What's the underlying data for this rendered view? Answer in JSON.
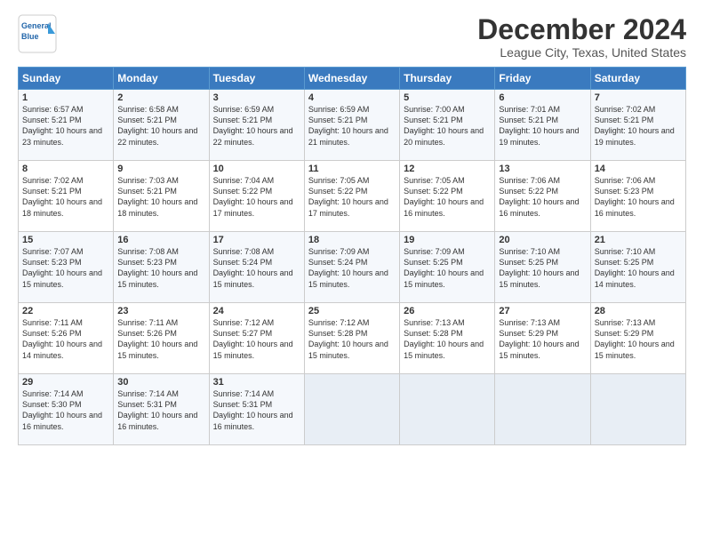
{
  "logo": {
    "line1": "General",
    "line2": "Blue"
  },
  "title": "December 2024",
  "subtitle": "League City, Texas, United States",
  "header": {
    "accent_color": "#3a7abf"
  },
  "days_of_week": [
    "Sunday",
    "Monday",
    "Tuesday",
    "Wednesday",
    "Thursday",
    "Friday",
    "Saturday"
  ],
  "weeks": [
    [
      {
        "num": "1",
        "sunrise": "Sunrise: 6:57 AM",
        "sunset": "Sunset: 5:21 PM",
        "daylight": "Daylight: 10 hours and 23 minutes."
      },
      {
        "num": "2",
        "sunrise": "Sunrise: 6:58 AM",
        "sunset": "Sunset: 5:21 PM",
        "daylight": "Daylight: 10 hours and 22 minutes."
      },
      {
        "num": "3",
        "sunrise": "Sunrise: 6:59 AM",
        "sunset": "Sunset: 5:21 PM",
        "daylight": "Daylight: 10 hours and 22 minutes."
      },
      {
        "num": "4",
        "sunrise": "Sunrise: 6:59 AM",
        "sunset": "Sunset: 5:21 PM",
        "daylight": "Daylight: 10 hours and 21 minutes."
      },
      {
        "num": "5",
        "sunrise": "Sunrise: 7:00 AM",
        "sunset": "Sunset: 5:21 PM",
        "daylight": "Daylight: 10 hours and 20 minutes."
      },
      {
        "num": "6",
        "sunrise": "Sunrise: 7:01 AM",
        "sunset": "Sunset: 5:21 PM",
        "daylight": "Daylight: 10 hours and 19 minutes."
      },
      {
        "num": "7",
        "sunrise": "Sunrise: 7:02 AM",
        "sunset": "Sunset: 5:21 PM",
        "daylight": "Daylight: 10 hours and 19 minutes."
      }
    ],
    [
      {
        "num": "8",
        "sunrise": "Sunrise: 7:02 AM",
        "sunset": "Sunset: 5:21 PM",
        "daylight": "Daylight: 10 hours and 18 minutes."
      },
      {
        "num": "9",
        "sunrise": "Sunrise: 7:03 AM",
        "sunset": "Sunset: 5:21 PM",
        "daylight": "Daylight: 10 hours and 18 minutes."
      },
      {
        "num": "10",
        "sunrise": "Sunrise: 7:04 AM",
        "sunset": "Sunset: 5:22 PM",
        "daylight": "Daylight: 10 hours and 17 minutes."
      },
      {
        "num": "11",
        "sunrise": "Sunrise: 7:05 AM",
        "sunset": "Sunset: 5:22 PM",
        "daylight": "Daylight: 10 hours and 17 minutes."
      },
      {
        "num": "12",
        "sunrise": "Sunrise: 7:05 AM",
        "sunset": "Sunset: 5:22 PM",
        "daylight": "Daylight: 10 hours and 16 minutes."
      },
      {
        "num": "13",
        "sunrise": "Sunrise: 7:06 AM",
        "sunset": "Sunset: 5:22 PM",
        "daylight": "Daylight: 10 hours and 16 minutes."
      },
      {
        "num": "14",
        "sunrise": "Sunrise: 7:06 AM",
        "sunset": "Sunset: 5:23 PM",
        "daylight": "Daylight: 10 hours and 16 minutes."
      }
    ],
    [
      {
        "num": "15",
        "sunrise": "Sunrise: 7:07 AM",
        "sunset": "Sunset: 5:23 PM",
        "daylight": "Daylight: 10 hours and 15 minutes."
      },
      {
        "num": "16",
        "sunrise": "Sunrise: 7:08 AM",
        "sunset": "Sunset: 5:23 PM",
        "daylight": "Daylight: 10 hours and 15 minutes."
      },
      {
        "num": "17",
        "sunrise": "Sunrise: 7:08 AM",
        "sunset": "Sunset: 5:24 PM",
        "daylight": "Daylight: 10 hours and 15 minutes."
      },
      {
        "num": "18",
        "sunrise": "Sunrise: 7:09 AM",
        "sunset": "Sunset: 5:24 PM",
        "daylight": "Daylight: 10 hours and 15 minutes."
      },
      {
        "num": "19",
        "sunrise": "Sunrise: 7:09 AM",
        "sunset": "Sunset: 5:25 PM",
        "daylight": "Daylight: 10 hours and 15 minutes."
      },
      {
        "num": "20",
        "sunrise": "Sunrise: 7:10 AM",
        "sunset": "Sunset: 5:25 PM",
        "daylight": "Daylight: 10 hours and 15 minutes."
      },
      {
        "num": "21",
        "sunrise": "Sunrise: 7:10 AM",
        "sunset": "Sunset: 5:25 PM",
        "daylight": "Daylight: 10 hours and 14 minutes."
      }
    ],
    [
      {
        "num": "22",
        "sunrise": "Sunrise: 7:11 AM",
        "sunset": "Sunset: 5:26 PM",
        "daylight": "Daylight: 10 hours and 14 minutes."
      },
      {
        "num": "23",
        "sunrise": "Sunrise: 7:11 AM",
        "sunset": "Sunset: 5:26 PM",
        "daylight": "Daylight: 10 hours and 15 minutes."
      },
      {
        "num": "24",
        "sunrise": "Sunrise: 7:12 AM",
        "sunset": "Sunset: 5:27 PM",
        "daylight": "Daylight: 10 hours and 15 minutes."
      },
      {
        "num": "25",
        "sunrise": "Sunrise: 7:12 AM",
        "sunset": "Sunset: 5:28 PM",
        "daylight": "Daylight: 10 hours and 15 minutes."
      },
      {
        "num": "26",
        "sunrise": "Sunrise: 7:13 AM",
        "sunset": "Sunset: 5:28 PM",
        "daylight": "Daylight: 10 hours and 15 minutes."
      },
      {
        "num": "27",
        "sunrise": "Sunrise: 7:13 AM",
        "sunset": "Sunset: 5:29 PM",
        "daylight": "Daylight: 10 hours and 15 minutes."
      },
      {
        "num": "28",
        "sunrise": "Sunrise: 7:13 AM",
        "sunset": "Sunset: 5:29 PM",
        "daylight": "Daylight: 10 hours and 15 minutes."
      }
    ],
    [
      {
        "num": "29",
        "sunrise": "Sunrise: 7:14 AM",
        "sunset": "Sunset: 5:30 PM",
        "daylight": "Daylight: 10 hours and 16 minutes."
      },
      {
        "num": "30",
        "sunrise": "Sunrise: 7:14 AM",
        "sunset": "Sunset: 5:31 PM",
        "daylight": "Daylight: 10 hours and 16 minutes."
      },
      {
        "num": "31",
        "sunrise": "Sunrise: 7:14 AM",
        "sunset": "Sunset: 5:31 PM",
        "daylight": "Daylight: 10 hours and 16 minutes."
      },
      null,
      null,
      null,
      null
    ]
  ]
}
